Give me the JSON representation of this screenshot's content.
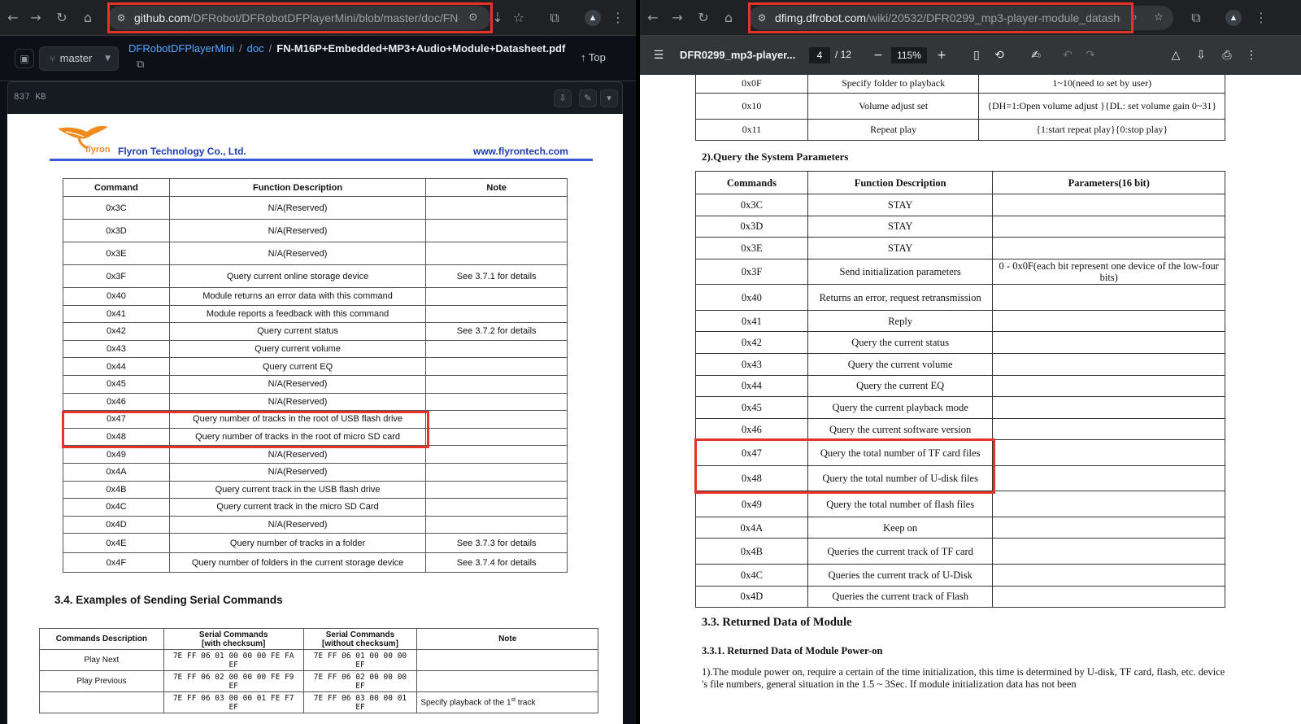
{
  "left_window": {
    "toolbar": {
      "back_icon": "arrow-left-icon",
      "forward_icon": "arrow-right-icon",
      "reload_icon": "reload-icon",
      "home_icon": "home-icon",
      "url_host": "github.com",
      "url_path": "/DFRobot/DFRobotDFPlayerMini/blob/master/doc/FN-M1..."
    },
    "github": {
      "branch": "master",
      "breadcrumb": {
        "repo": "DFRobotDFPlayerMini",
        "folder": "doc",
        "file": "FN-M16P+Embedded+MP3+Audio+Module+Datasheet.pdf"
      },
      "top_label": "Top",
      "file_size": "837 KB"
    },
    "pdf": {
      "logo_text": "flyron",
      "company": "Flyron Technology Co., Ltd.",
      "website": "www.flyrontech.com",
      "table_headers": [
        "Command",
        "Function Description",
        "Note"
      ],
      "rows": [
        {
          "cmd": "0x3C",
          "desc": "N/A(Reserved)",
          "note": ""
        },
        {
          "cmd": "0x3D",
          "desc": "N/A(Reserved)",
          "note": ""
        },
        {
          "cmd": "0x3E",
          "desc": "N/A(Reserved)",
          "note": ""
        },
        {
          "cmd": "0x3F",
          "desc": "Query current online storage device",
          "note": "See 3.7.1 for details"
        },
        {
          "cmd": "0x40",
          "desc": "Module returns an error data with this command",
          "note": ""
        },
        {
          "cmd": "0x41",
          "desc": "Module reports a feedback with this command",
          "note": ""
        },
        {
          "cmd": "0x42",
          "desc": "Query current status",
          "note": "See 3.7.2 for details"
        },
        {
          "cmd": "0x43",
          "desc": "Query current volume",
          "note": ""
        },
        {
          "cmd": "0x44",
          "desc": "Query current EQ",
          "note": ""
        },
        {
          "cmd": "0x45",
          "desc": "N/A(Reserved)",
          "note": ""
        },
        {
          "cmd": "0x46",
          "desc": "N/A(Reserved)",
          "note": ""
        },
        {
          "cmd": "0x47",
          "desc": "Query number of tracks in the root of USB flash drive",
          "note": ""
        },
        {
          "cmd": "0x48",
          "desc": "Query number of tracks in the root of micro SD card",
          "note": ""
        },
        {
          "cmd": "0x49",
          "desc": "N/A(Reserved)",
          "note": ""
        },
        {
          "cmd": "0x4A",
          "desc": "N/A(Reserved)",
          "note": ""
        },
        {
          "cmd": "0x4B",
          "desc": "Query current track in the USB flash drive",
          "note": ""
        },
        {
          "cmd": "0x4C",
          "desc": "Query current track in the micro SD Card",
          "note": ""
        },
        {
          "cmd": "0x4D",
          "desc": "N/A(Reserved)",
          "note": ""
        },
        {
          "cmd": "0x4E",
          "desc": "Query number of tracks in a folder",
          "note": "See 3.7.3 for details"
        },
        {
          "cmd": "0x4F",
          "desc": "Query number of folders in the current storage device",
          "note": "See 3.7.4 for details"
        }
      ],
      "section_title": "3.4. Examples of Sending Serial Commands",
      "examples_headers": {
        "desc": "Commands Description",
        "with_checksum_1": "Serial Commands",
        "with_checksum_2": "[with checksum]",
        "without_checksum_1": "Serial Commands",
        "without_checksum_2": "[without checksum]",
        "note": "Note"
      },
      "examples": [
        {
          "desc": "Play Next",
          "with": "7E FF 06 01 00 00 00 FE FA EF",
          "without": "7E FF 06 01 00 00 00 EF",
          "note": ""
        },
        {
          "desc": "Play Previous",
          "with": "7E FF 06 02 00 00 00 FE F9 EF",
          "without": "7E FF 06 02 00 00 00 EF",
          "note": ""
        },
        {
          "desc": "",
          "with": "7E FF 06 03 00 00 01 FE F7 EF",
          "without": "7E FF 06 03 00 00 01 EF",
          "note_pre": "Specify playback of the 1",
          "note_sup": "st",
          "note_post": " track"
        }
      ]
    }
  },
  "right_window": {
    "toolbar": {
      "url_host": "dfimg.dfrobot.com",
      "url_path": "/wiki/20532/DFR0299_mp3-player-module_datashee..."
    },
    "pdf_viewer": {
      "title": "DFR0299_mp3-player...",
      "page_current": "4",
      "page_total": "/ 12",
      "zoom": "115%",
      "zoom_out": "−",
      "zoom_in": "+"
    },
    "doc": {
      "top_rows": [
        {
          "cmd": "0x0F",
          "desc": "Specify folder to playback",
          "param": "1~10(need to set by user)"
        },
        {
          "cmd": "0x10",
          "desc": "Volume adjust set",
          "param": "{DH=1:Open volume adjust }{DL: set volume gain 0~31}"
        },
        {
          "cmd": "0x11",
          "desc": "Repeat play",
          "param": "{1:start repeat play}{0:stop play}"
        }
      ],
      "section_2_title": "2).Query the System Parameters",
      "headers": [
        "Commands",
        "Function Description",
        "Parameters(16 bit)"
      ],
      "rows": [
        {
          "cmd": "0x3C",
          "desc": "STAY",
          "param": ""
        },
        {
          "cmd": "0x3D",
          "desc": "STAY",
          "param": ""
        },
        {
          "cmd": "0x3E",
          "desc": "STAY",
          "param": ""
        },
        {
          "cmd": "0x3F",
          "desc": "Send initialization parameters",
          "param": "0 - 0x0F(each bit represent one device of the low-four bits)"
        },
        {
          "cmd": "0x40",
          "desc": "Returns an error, request retransmission",
          "param": ""
        },
        {
          "cmd": "0x41",
          "desc": "Reply",
          "param": ""
        },
        {
          "cmd": "0x42",
          "desc": "Query the current status",
          "param": ""
        },
        {
          "cmd": "0x43",
          "desc": "Query the current volume",
          "param": ""
        },
        {
          "cmd": "0x44",
          "desc": "Query the current EQ",
          "param": ""
        },
        {
          "cmd": "0x45",
          "desc": "Query the current playback mode",
          "param": ""
        },
        {
          "cmd": "0x46",
          "desc": "Query the current software version",
          "param": ""
        },
        {
          "cmd": "0x47",
          "desc": "Query the total number of TF card files",
          "param": ""
        },
        {
          "cmd": "0x48",
          "desc": "Query the total number of U-disk files",
          "param": ""
        },
        {
          "cmd": "0x49",
          "desc": "Query the total number of flash files",
          "param": ""
        },
        {
          "cmd": "0x4A",
          "desc": "Keep on",
          "param": ""
        },
        {
          "cmd": "0x4B",
          "desc": "Queries the current track of TF card",
          "param": ""
        },
        {
          "cmd": "0x4C",
          "desc": "Queries the current track of U-Disk",
          "param": ""
        },
        {
          "cmd": "0x4D",
          "desc": "Queries the current track of Flash",
          "param": ""
        }
      ],
      "section_33_title": "3.3. Returned Data of Module",
      "section_331_title": "3.3.1. Returned Data of Module Power-on",
      "paragraph": "1).The module power on, require a certain of the time initialization, this time is determined by U-disk, TF card, flash, etc. device 's file numbers, general situation in the 1.5 ~ 3Sec. If module initialization data has not been"
    }
  },
  "highlight_color": "#e5332a"
}
